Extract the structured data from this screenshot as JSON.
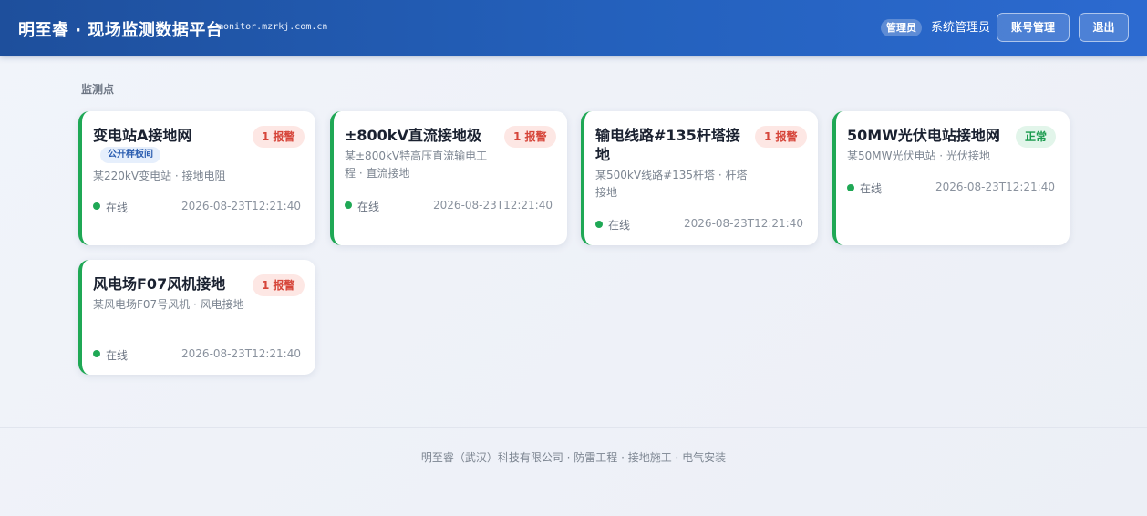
{
  "header": {
    "brand": "明至睿 · 现场监测数据平台",
    "domain": "monitor.mzrkj.com.cn",
    "role_badge": "管理员",
    "user_name": "系统管理员",
    "account_button": "账号管理",
    "logout_button": "退出"
  },
  "section_title": "监测点",
  "cards": [
    {
      "title": "变电站A接地网",
      "tag": "1 报警",
      "sample_tag": "公开样板间",
      "subtitle": "某220kV变电站 · 接地电阻",
      "status": "在线",
      "time": "2026-08-23T12:21:40"
    },
    {
      "title": "±800kV直流接地极",
      "tag": "1 报警",
      "subtitle": "某±800kV特高压直流输电工程 · 直流接地",
      "status": "在线",
      "time": "2026-08-23T12:21:40"
    },
    {
      "title": "输电线路#135杆塔接地",
      "tag": "1 报警",
      "subtitle": "某500kV线路#135杆塔 · 杆塔接地",
      "status": "在线",
      "time": "2026-08-23T12:21:40"
    },
    {
      "title": "50MW光伏电站接地网",
      "tag": "正常",
      "subtitle": "某50MW光伏电站 · 光伏接地",
      "status": "在线",
      "time": "2026-08-23T12:21:40"
    },
    {
      "title": "风电场F07风机接地",
      "tag": "1 报警",
      "subtitle": "某风电场F07号风机 · 风电接地",
      "status": "在线",
      "time": "2026-08-23T12:21:40"
    }
  ],
  "colors": {
    "header_start": "#1e4f9c",
    "header_end": "#2c6ad0",
    "online_green": "#1fa855",
    "alarm_red": "#d6453a",
    "alarm_bg": "#fde7e4",
    "ok_bg": "#e2f5ea"
  },
  "footer": "明至睿（武汉）科技有限公司 · 防雷工程 · 接地施工 · 电气安装"
}
